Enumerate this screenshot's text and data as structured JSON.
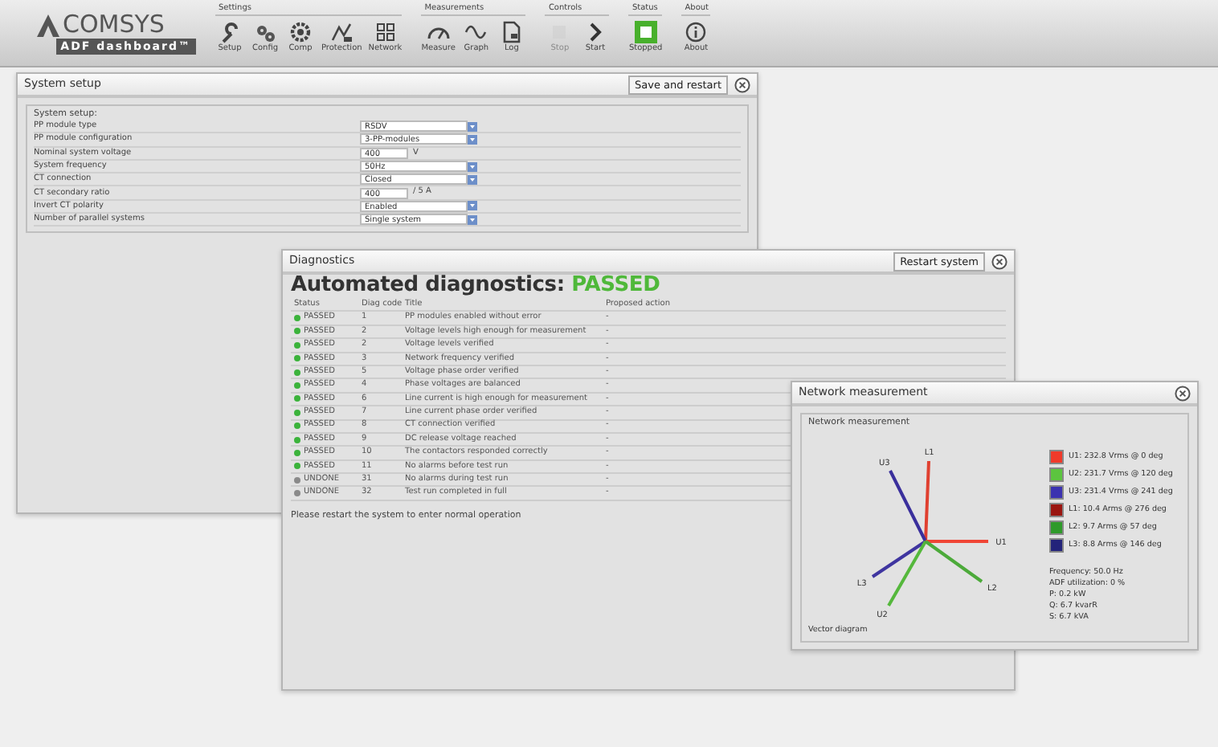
{
  "toolbar": {
    "logo": {
      "name": "COMSYS",
      "subtitle": "ADF dashboard™"
    },
    "groups": [
      {
        "title": "Settings",
        "items": [
          {
            "label": "Setup",
            "disabled": false
          },
          {
            "label": "Config",
            "disabled": false
          },
          {
            "label": "Comp",
            "disabled": false
          },
          {
            "label": "Protection",
            "disabled": false
          },
          {
            "label": "Network",
            "disabled": false
          }
        ]
      },
      {
        "title": "Measurements",
        "items": [
          {
            "label": "Measure",
            "disabled": false
          },
          {
            "label": "Graph",
            "disabled": false
          },
          {
            "label": "Log",
            "disabled": false
          }
        ]
      },
      {
        "title": "Controls",
        "items": [
          {
            "label": "Stop",
            "disabled": true
          },
          {
            "label": "Start",
            "disabled": false
          }
        ]
      },
      {
        "title": "Status",
        "items": [
          {
            "label": "Stopped",
            "disabled": false
          }
        ]
      },
      {
        "title": "About",
        "items": [
          {
            "label": "About",
            "disabled": false
          }
        ]
      }
    ]
  },
  "system_setup": {
    "title": "System setup",
    "button": "Save and restart",
    "section": "System setup:",
    "rows": [
      {
        "label": "PP module type",
        "kind": "select",
        "value": "RSDV"
      },
      {
        "label": "PP module configuration",
        "kind": "select",
        "value": "3-PP-modules"
      },
      {
        "label": "Nominal system voltage",
        "kind": "input",
        "value": "400",
        "unit": "V"
      },
      {
        "label": "System frequency",
        "kind": "select",
        "value": "50Hz"
      },
      {
        "label": "CT connection",
        "kind": "select",
        "value": "Closed"
      },
      {
        "label": "CT secondary ratio",
        "kind": "input",
        "value": "400",
        "unit": "/ 5 A"
      },
      {
        "label": "Invert CT polarity",
        "kind": "select",
        "value": "Enabled"
      },
      {
        "label": "Number of parallel systems",
        "kind": "select",
        "value": "Single system"
      }
    ]
  },
  "diagnostics": {
    "title": "Diagnostics",
    "button": "Restart system",
    "heading": "Automated diagnostics:",
    "result": "PASSED",
    "columns": [
      "Status",
      "Diag code",
      "Title",
      "Proposed action"
    ],
    "rows": [
      {
        "status": "PASSED",
        "color": "#3bb33b",
        "code": "1",
        "title": "PP modules enabled without error",
        "action": "-"
      },
      {
        "status": "PASSED",
        "color": "#3bb33b",
        "code": "2",
        "title": "Voltage levels high enough for measurement",
        "action": "-"
      },
      {
        "status": "PASSED",
        "color": "#3bb33b",
        "code": "2",
        "title": "Voltage levels verified",
        "action": "-"
      },
      {
        "status": "PASSED",
        "color": "#3bb33b",
        "code": "3",
        "title": "Network frequency verified",
        "action": "-"
      },
      {
        "status": "PASSED",
        "color": "#3bb33b",
        "code": "5",
        "title": "Voltage phase order verified",
        "action": "-"
      },
      {
        "status": "PASSED",
        "color": "#3bb33b",
        "code": "4",
        "title": "Phase voltages are balanced",
        "action": "-"
      },
      {
        "status": "PASSED",
        "color": "#3bb33b",
        "code": "6",
        "title": "Line current is high enough for measurement",
        "action": "-"
      },
      {
        "status": "PASSED",
        "color": "#3bb33b",
        "code": "7",
        "title": "Line current phase order verified",
        "action": "-"
      },
      {
        "status": "PASSED",
        "color": "#3bb33b",
        "code": "8",
        "title": "CT connection verified",
        "action": "-"
      },
      {
        "status": "PASSED",
        "color": "#3bb33b",
        "code": "9",
        "title": "DC release voltage reached",
        "action": "-"
      },
      {
        "status": "PASSED",
        "color": "#3bb33b",
        "code": "10",
        "title": "The contactors responded correctly",
        "action": "-"
      },
      {
        "status": "PASSED",
        "color": "#3bb33b",
        "code": "11",
        "title": "No alarms before test run",
        "action": "-"
      },
      {
        "status": "UNDONE",
        "color": "#8a8a8a",
        "code": "31",
        "title": "No alarms during test run",
        "action": "-"
      },
      {
        "status": "UNDONE",
        "color": "#8a8a8a",
        "code": "32",
        "title": "Test run completed in full",
        "action": "-"
      }
    ],
    "footer": "Please restart the system to enter normal operation"
  },
  "network": {
    "title": "Network measurement",
    "section": "Network measurement",
    "vectors": [
      {
        "label": "L1",
        "color": "#e04030"
      },
      {
        "label": "U3",
        "color": "#3a2f9c"
      },
      {
        "label": "U1",
        "color": "#f04535"
      },
      {
        "label": "L3",
        "color": "#3f35a0"
      },
      {
        "label": "U2",
        "color": "#55b83c"
      },
      {
        "label": "L2",
        "color": "#4caa3a"
      }
    ],
    "caption": "Vector diagram",
    "legend": [
      {
        "color": "#f03a2a",
        "text": "U1: 232.8 Vrms @ 0 deg"
      },
      {
        "color": "#5cc43f",
        "text": "U2: 231.7 Vrms @ 120 deg"
      },
      {
        "color": "#3b32b0",
        "text": "U3: 231.4 Vrms @ 241 deg"
      },
      {
        "color": "#9a1510",
        "text": "L1: 10.4 Arms @ 276 deg"
      },
      {
        "color": "#2f9a2a",
        "text": "L2: 9.7 Arms @ 57 deg"
      },
      {
        "color": "#23237a",
        "text": "L3: 8.8 Arms @ 146 deg"
      }
    ],
    "stats": [
      "Frequency: 50.0 Hz",
      "ADF utilization: 0 %",
      "P: 0.2 kW",
      "Q: 6.7 kvarR",
      "S: 6.7 kVA"
    ]
  }
}
